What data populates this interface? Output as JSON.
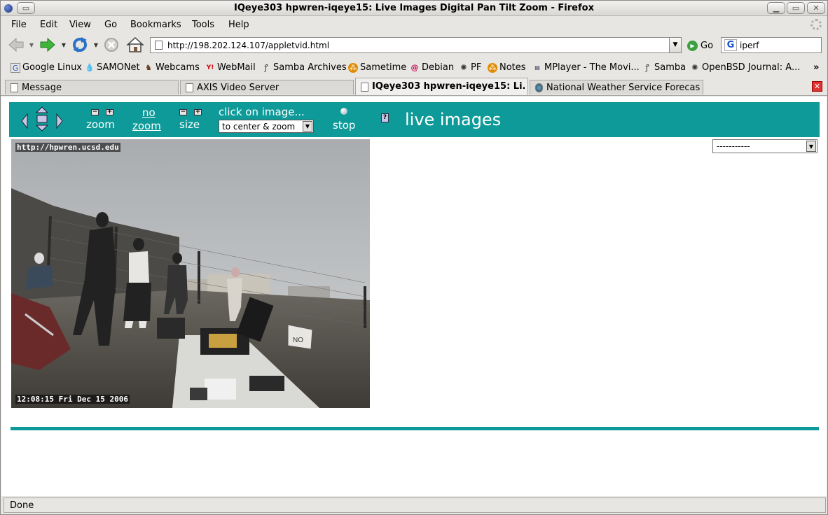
{
  "window": {
    "title": "IQeye303 hpwren-iqeye15: Live Images Digital Pan Tilt Zoom - Firefox"
  },
  "menubar": {
    "items": [
      "File",
      "Edit",
      "View",
      "Go",
      "Bookmarks",
      "Tools",
      "Help"
    ]
  },
  "navbar": {
    "url": "http://198.202.124.107/appletvid.html",
    "go_label": "Go",
    "search_value": "iperf"
  },
  "bookmarks": [
    {
      "label": "Google Linux",
      "icon": "google-icon"
    },
    {
      "label": "SAMONet",
      "icon": "drupal-icon"
    },
    {
      "label": "Webcams",
      "icon": "dog-icon"
    },
    {
      "label": "WebMail",
      "icon": "yahoo-icon"
    },
    {
      "label": "Samba Archives",
      "icon": "samba-icon"
    },
    {
      "label": "Sametime",
      "icon": "sametime-icon"
    },
    {
      "label": "Debian",
      "icon": "debian-icon"
    },
    {
      "label": "PF",
      "icon": "puffy-icon"
    },
    {
      "label": "Notes",
      "icon": "notes-icon"
    },
    {
      "label": "MPlayer - The Movi...",
      "icon": "mplayer-icon"
    },
    {
      "label": "Samba",
      "icon": "samba-icon"
    },
    {
      "label": "OpenBSD Journal: A...",
      "icon": "puffy-icon"
    }
  ],
  "bookmarks_overflow": "»",
  "tabs": [
    {
      "label": "Message",
      "active": false
    },
    {
      "label": "AXIS Video Server",
      "active": false
    },
    {
      "label": "IQeye303 hpwren-iqeye15: Li...",
      "active": true
    },
    {
      "label": "National Weather Service Forecast ...",
      "active": false
    }
  ],
  "cam_toolbar": {
    "zoom_label": "zoom",
    "no_zoom_line1": "no",
    "no_zoom_line2": "zoom",
    "size_label": "size",
    "click_label": "click on image...",
    "zoom_mode_value": "to center & zoom",
    "stop_label": "stop",
    "help_label": "?",
    "title": "live images"
  },
  "camera": {
    "url_overlay": "http://hpwren.ucsd.edu",
    "timestamp_overlay": "12:08:15 Fri Dec 15 2006",
    "sign_text": "NO"
  },
  "preset_select": {
    "value": "-----------"
  },
  "statusbar": {
    "text": "Done"
  },
  "colors": {
    "accent_teal": "#0e9a98"
  }
}
